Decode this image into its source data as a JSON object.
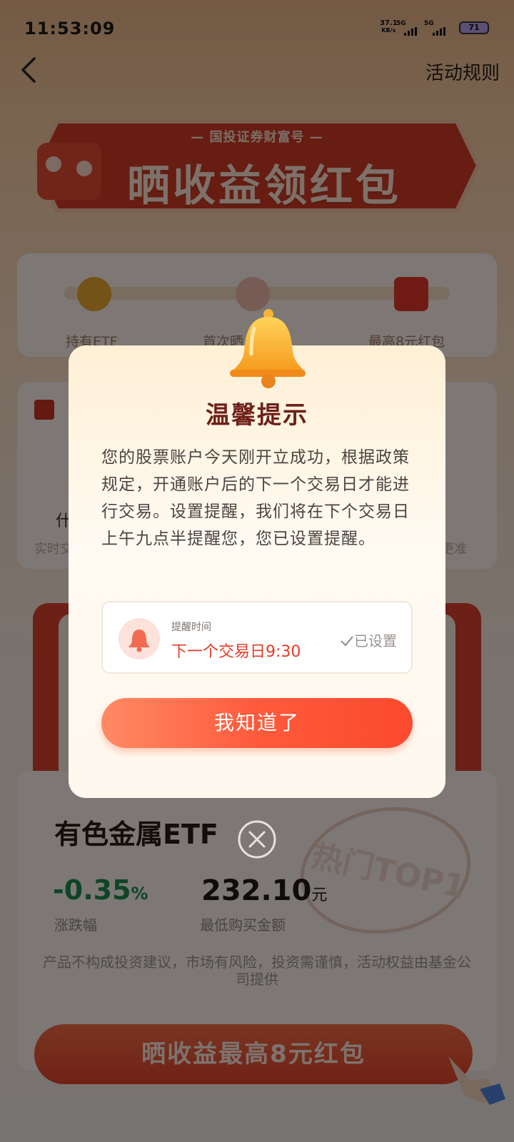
{
  "status_bar": {
    "time": "11:53:09",
    "net_speed_value": "37.1",
    "net_speed_unit": "KB/s",
    "signal1": "5G",
    "signal2": "5G",
    "battery": "71"
  },
  "nav": {
    "rules_label": "活动规则"
  },
  "banner": {
    "subtitle": "— 国投证券财富号 —",
    "title": "晒收益领红包"
  },
  "steps": {
    "items": [
      {
        "label": "持有ETF"
      },
      {
        "label": "首次晒…益"
      },
      {
        "label": "最高8元红包"
      }
    ]
  },
  "info_card": {
    "fragment_left": "实时交",
    "fragment_right": "更准",
    "question_fragment": "什"
  },
  "product": {
    "name": "有色金属ETF",
    "change_value": "-0.35",
    "change_unit": "%",
    "change_label": "涨跌幅",
    "min_amount_value": "232.10",
    "min_amount_unit": "元",
    "min_amount_label": "最低购买金额",
    "stamp_text": "热门TOP1",
    "disclaimer": "产品不构成投资建议，市场有风险，投资需谨慎，活动权益由基金公司提供",
    "share_button": "晒收益最高8元红包"
  },
  "dialog": {
    "title": "温馨提示",
    "body": "您的股票账户今天刚开立成功，根据政策规定，开通账户后的下一个交易日才能进行交易。设置提醒，我们将在下个交易日上午九点半提醒您，您已设置提醒。",
    "remind_label": "提醒时间",
    "remind_value": "下一个交易日9:30",
    "remind_status": "已设置",
    "confirm_button": "我知道了"
  },
  "colors": {
    "accent": "#ff5a3c",
    "dialog_title": "#6e2018",
    "remind_value": "#e33b25",
    "change_negative": "#1d8b4c"
  }
}
